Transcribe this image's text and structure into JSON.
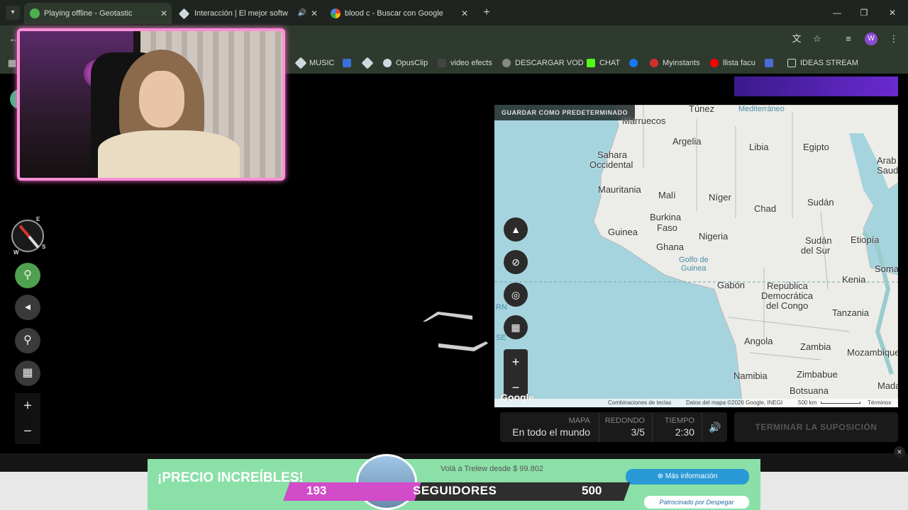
{
  "browser": {
    "tabs": [
      {
        "label": "Playing offline - Geotastic",
        "favicon_color": "#4caf50",
        "active": true
      },
      {
        "label": "Interacción | El mejor softw",
        "favicon_color": "#cfd8dc",
        "active": false
      },
      {
        "label": "blood c - Buscar con Google",
        "favicon_color": "#ffffff",
        "active": false
      }
    ],
    "profile_initial": "W",
    "bookmarks": [
      {
        "label": "MUSIC",
        "color": "#cfd8dc"
      },
      {
        "label": "",
        "color": "#3b6fd9"
      },
      {
        "label": "",
        "color": "#cfd8dc"
      },
      {
        "label": "OpusClip",
        "color": "#cfd8dc"
      },
      {
        "label": "video efects",
        "color": "#222"
      },
      {
        "label": "DESCARGAR VOD",
        "color": "#cfd8dc"
      },
      {
        "label": "CHAT",
        "color": "#53fc18"
      },
      {
        "label": "",
        "color": "#1877f2"
      },
      {
        "label": "Myinstants",
        "color": "#d32f2f"
      },
      {
        "label": "llista facu",
        "color": "#ff0000"
      },
      {
        "label": "",
        "color": "#4a6bd6"
      },
      {
        "label": "IDEAS STREAM",
        "color": "#cfd8dc"
      }
    ]
  },
  "compass": {
    "labels": [
      "E",
      "S",
      "W"
    ]
  },
  "map": {
    "save_default_label": "GUARDAR COMO PREDETERMINADO",
    "labels": [
      "Túnez",
      "Mediterráneo",
      "Marruecos",
      "Argelia",
      "Libia",
      "Egipto",
      "Arab",
      "Saud",
      "Sahara",
      "Occidental",
      "Mauritania",
      "Malí",
      "Níger",
      "Chad",
      "Sudán",
      "Burkina",
      "Faso",
      "Guinea",
      "Nigeria",
      "Ghana",
      "Sudán",
      "del Sur",
      "Etiopía",
      "Golfo de",
      "Guinea",
      "Soma",
      "Kenia",
      "Gabón",
      "República",
      "Democrática",
      "del Congo",
      "Tanzania",
      "Angola",
      "Zambia",
      "Mozambique",
      "Namibia",
      "Zimbabue",
      "Botsuana",
      "Madag",
      "RN",
      "SE"
    ],
    "google": "Google",
    "footer": {
      "shortcuts": "Combinaciones de teclas",
      "data": "Datos del mapa ©2026 Google, INEGI",
      "scale": "500 km",
      "terms": "Términos"
    }
  },
  "status": {
    "map_label": "MAPA",
    "map_value": "En todo el mundo",
    "round_label": "REDONDO",
    "round_value": "3/5",
    "time_label": "TIEMPO",
    "time_value": "2:30"
  },
  "finish_button": "TERMINAR LA SUPOSICIÓN",
  "ad": {
    "headline": "¡PRECIO INCREÍBLES!",
    "sub": "Volá a Trelew desde $ 99.802",
    "more_info": "Más información",
    "sponsor": "Patrocinado por Despegar"
  },
  "followers": {
    "current": "193",
    "label": "SEGUIDORES",
    "goal": "500",
    "progress": 0.386
  }
}
